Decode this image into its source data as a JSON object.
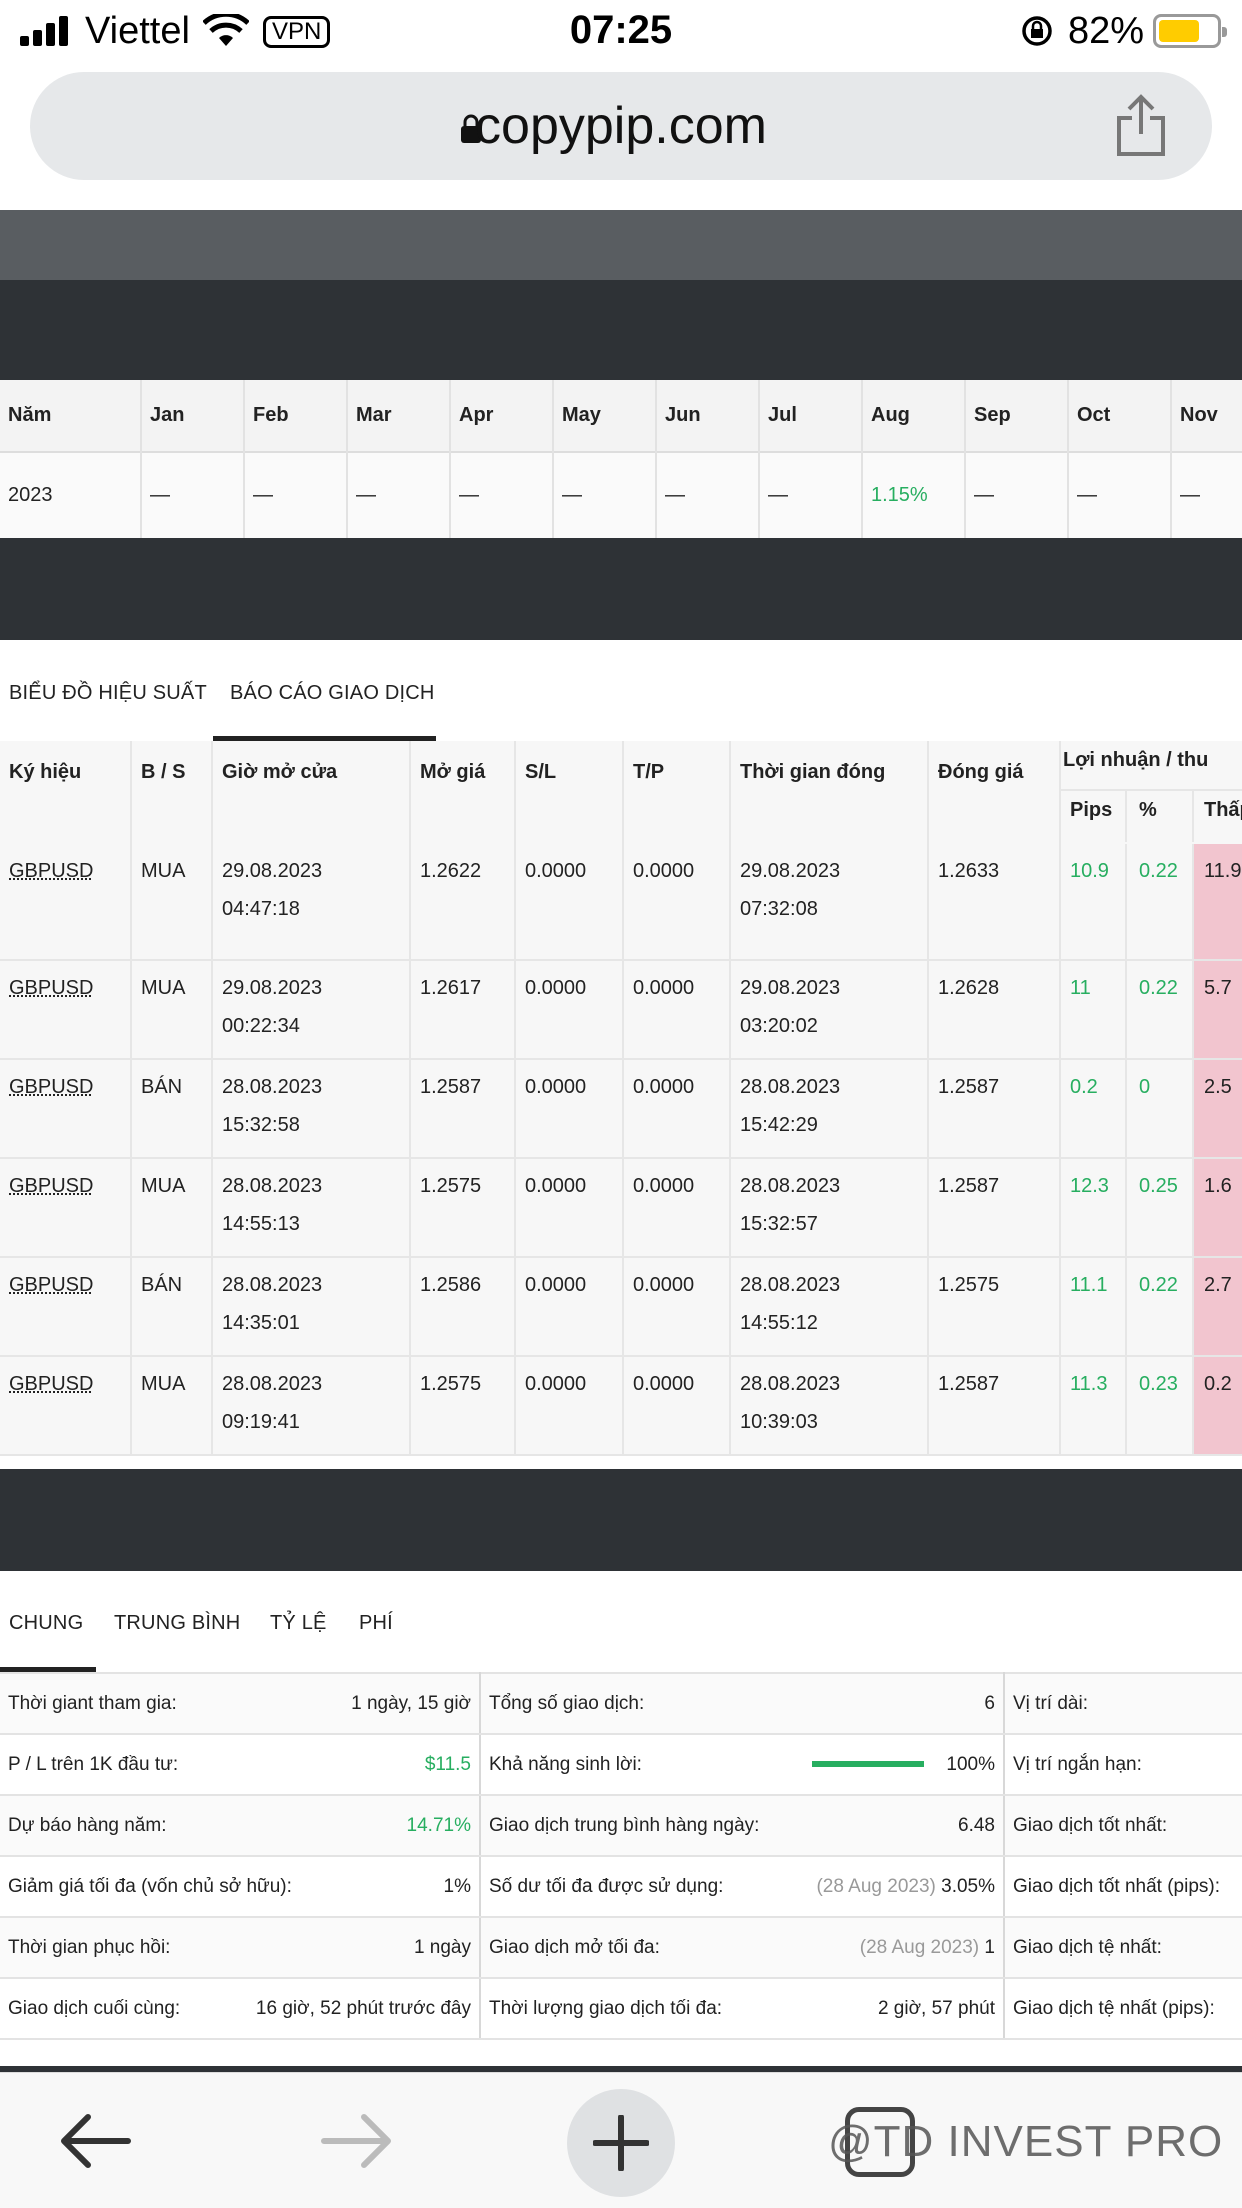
{
  "status": {
    "carrier": "Viettel",
    "vpn": "VPN",
    "time": "07:25",
    "battery": "82%"
  },
  "browser": {
    "url": "copypip.com",
    "watermark": "@TD INVEST PRO"
  },
  "monthly": {
    "headers": [
      "Năm",
      "Jan",
      "Feb",
      "Mar",
      "Apr",
      "May",
      "Jun",
      "Jul",
      "Aug",
      "Sep",
      "Oct",
      "Nov"
    ],
    "row": [
      "2023",
      "—",
      "—",
      "—",
      "—",
      "—",
      "—",
      "—",
      "1.15%",
      "—",
      "—",
      "—"
    ]
  },
  "tabs1": [
    "BIỂU ĐỒ HIỆU SUẤT",
    "BÁO CÁO GIAO DỊCH"
  ],
  "trades": {
    "headers": [
      "Ký hiệu",
      "B / S",
      "Giờ mở cửa",
      "Mở giá",
      "S/L",
      "T/P",
      "Thời gian đóng",
      "Đóng giá"
    ],
    "profit_header": "Lợi nhuận / thu",
    "sub": [
      "Pips",
      "%",
      "Thấp"
    ],
    "rows": [
      {
        "sym": "GBPUSD",
        "bs": "MUA",
        "od": "29.08.2023",
        "ot": "04:47:18",
        "op": "1.2622",
        "sl": "0.0000",
        "tp": "0.0000",
        "cd": "29.08.2023",
        "ct": "07:32:08",
        "cp": "1.2633",
        "pips": "10.9",
        "pct": "0.22",
        "low": "11.9"
      },
      {
        "sym": "GBPUSD",
        "bs": "MUA",
        "od": "29.08.2023",
        "ot": "00:22:34",
        "op": "1.2617",
        "sl": "0.0000",
        "tp": "0.0000",
        "cd": "29.08.2023",
        "ct": "03:20:02",
        "cp": "1.2628",
        "pips": "11",
        "pct": "0.22",
        "low": "5.7"
      },
      {
        "sym": "GBPUSD",
        "bs": "BÁN",
        "od": "28.08.2023",
        "ot": "15:32:58",
        "op": "1.2587",
        "sl": "0.0000",
        "tp": "0.0000",
        "cd": "28.08.2023",
        "ct": "15:42:29",
        "cp": "1.2587",
        "pips": "0.2",
        "pct": "0",
        "low": "2.5"
      },
      {
        "sym": "GBPUSD",
        "bs": "MUA",
        "od": "28.08.2023",
        "ot": "14:55:13",
        "op": "1.2575",
        "sl": "0.0000",
        "tp": "0.0000",
        "cd": "28.08.2023",
        "ct": "15:32:57",
        "cp": "1.2587",
        "pips": "12.3",
        "pct": "0.25",
        "low": "1.6"
      },
      {
        "sym": "GBPUSD",
        "bs": "BÁN",
        "od": "28.08.2023",
        "ot": "14:35:01",
        "op": "1.2586",
        "sl": "0.0000",
        "tp": "0.0000",
        "cd": "28.08.2023",
        "ct": "14:55:12",
        "cp": "1.2575",
        "pips": "11.1",
        "pct": "0.22",
        "low": "2.7"
      },
      {
        "sym": "GBPUSD",
        "bs": "MUA",
        "od": "28.08.2023",
        "ot": "09:19:41",
        "op": "1.2575",
        "sl": "0.0000",
        "tp": "0.0000",
        "cd": "28.08.2023",
        "ct": "10:39:03",
        "cp": "1.2587",
        "pips": "11.3",
        "pct": "0.23",
        "low": "0.2"
      }
    ]
  },
  "tabs2": [
    "CHUNG",
    "TRUNG BÌNH",
    "TỶ LỆ",
    "PHÍ"
  ],
  "stats": [
    {
      "l1": "Thời giant tham gia:",
      "v1": "1 ngày, 15 giờ",
      "l2": "Tổng số giao dịch:",
      "d2": "",
      "v2": "6",
      "l3": "Vị trí dài:"
    },
    {
      "l1": "P / L trên 1K đầu tư:",
      "v1": "$11.5",
      "l2": "Khả năng sinh lời:",
      "d2": "",
      "v2": "100%",
      "l3": "Vị trí ngắn hạn:"
    },
    {
      "l1": "Dự báo hàng năm:",
      "v1": "14.71%",
      "l2": "Giao dịch trung bình hàng ngày:",
      "d2": "",
      "v2": "6.48",
      "l3": "Giao dịch tốt nhất:"
    },
    {
      "l1": "Giảm giá tối đa (vốn chủ sở hữu):",
      "v1": "1%",
      "l2": "Số dư tối đa được sử dụng:",
      "d2": "(28 Aug 2023)",
      "v2": "3.05%",
      "l3": "Giao dịch tốt nhất (pips):"
    },
    {
      "l1": "Thời gian phục hồi:",
      "v1": "1 ngày",
      "l2": "Giao dịch mở tối đa:",
      "d2": "(28 Aug 2023)",
      "v2": "1",
      "l3": "Giao dịch tệ nhất:"
    },
    {
      "l1": "Giao dịch cuối cùng:",
      "v1": "16 giờ, 52 phút trước đây",
      "l2": "Thời lượng giao dịch tối đa:",
      "d2": "",
      "v2": "2 giờ, 57 phút",
      "l3": "Giao dịch tệ nhất (pips):"
    }
  ],
  "profitability": 1.0,
  "colors": {
    "green": "#27ae60",
    "dark": "#2e3236",
    "pink": "#f2c5cf"
  }
}
